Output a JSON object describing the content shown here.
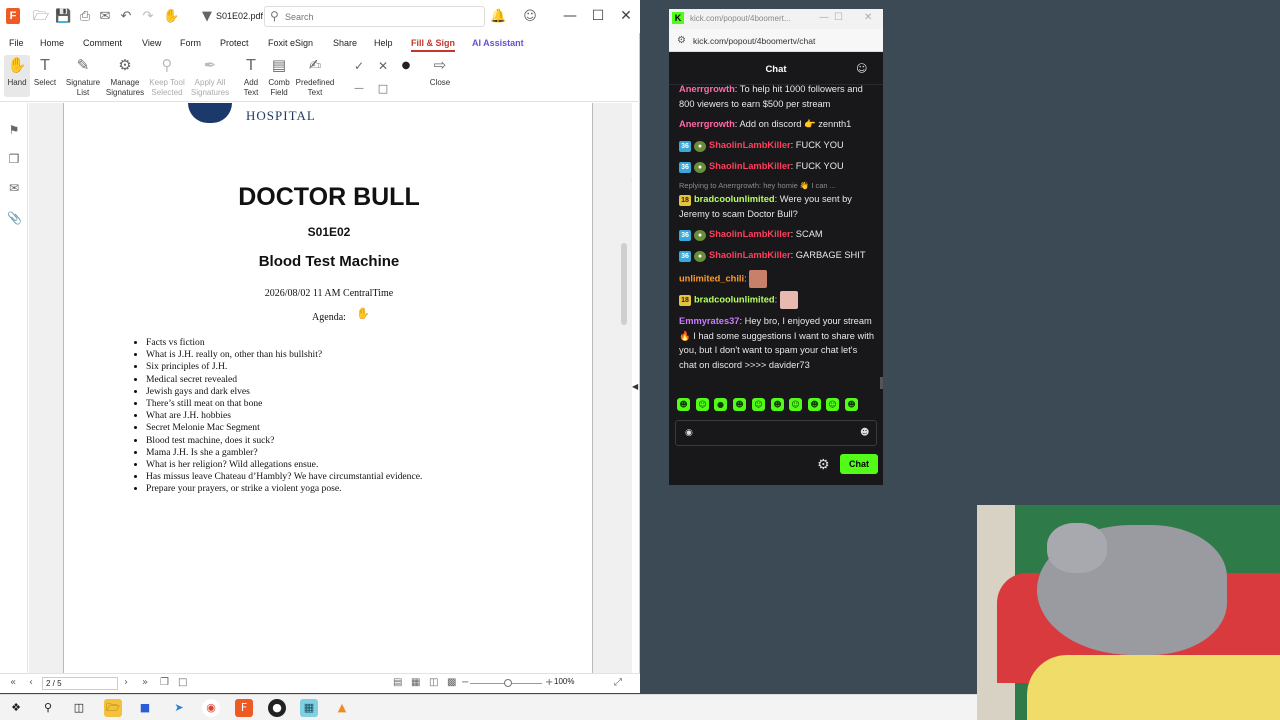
{
  "pdf": {
    "doc_name": "S01E02.pdf *",
    "search_placeholder": "Search",
    "menu": [
      "File",
      "Home",
      "Comment",
      "View",
      "Form",
      "Protect",
      "Foxit eSign",
      "Share",
      "Help",
      "Fill & Sign",
      "AI Assistant"
    ],
    "ribbon": {
      "hand": "Hand",
      "select": "Select",
      "signature_list": "Signature List",
      "manage_signatures": "Manage Signatures",
      "keep_tool_selected": "Keep Tool Selected",
      "apply_all_signatures": "Apply All Signatures",
      "add_text": "Add Text",
      "comb_field": "Comb Field",
      "predefined_text": "Predefined Text",
      "close": "Close"
    },
    "document": {
      "hospital": "HOSPITAL",
      "title": "DOCTOR BULL",
      "episode": "S01E02",
      "subtitle": "Blood Test Machine",
      "datetime": "2026/08/02 11 AM CentralTime",
      "agenda_label": "Agenda:",
      "agenda": [
        "Facts vs fiction",
        "What is J.H. really on, other than his bullshit?",
        "Six principles of J.H.",
        "Medical secret revealed",
        "Jewish gays and dark elves",
        "There’s still meat on that bone",
        "What are J.H. hobbies",
        "Secret Melonie Mac Segment",
        "Blood test machine, does it suck?",
        "Mama J.H. Is she a gambler?",
        "What is her religion? Wild allegations ensue.",
        "Has missus leave Chateau d’Hambly? We have circumstantial evidence.",
        "Prepare your prayers, or strike a violent yoga pose."
      ]
    },
    "status": {
      "page": "2 / 5",
      "zoom": "100%"
    }
  },
  "chat": {
    "window_title": "kick.com/popout/4boomert...",
    "url": "kick.com/popout/4boomertv/chat",
    "heading": "Chat",
    "messages": [
      {
        "user": "Anerrgrowth",
        "text": "To help hit 1000 followers and 800 viewers to earn $500 per stream"
      },
      {
        "user": "Anerrgrowth",
        "text": "Add on discord 👉 zennth1"
      },
      {
        "user": "ShaolinLambKiller",
        "text": "FUCK YOU"
      },
      {
        "user": "ShaolinLambKiller",
        "text": "FUCK YOU"
      },
      {
        "reply": "Replying to Anerrgrowth: hey homie 👋 I can ...",
        "user": "bradcoolunlimited",
        "text": "Were you sent by Jeremy to scam Doctor Bull?"
      },
      {
        "user": "ShaolinLambKiller",
        "text": "SCAM"
      },
      {
        "user": "ShaolinLambKiller",
        "text": "GARBAGE SHIT"
      },
      {
        "user": "unlimited_chili",
        "text": ""
      },
      {
        "user": "bradcoolunlimited",
        "text": ""
      },
      {
        "user": "Emmyrates37",
        "text": "Hey bro, I enjoyed your stream 🔥 I had some suggestions I want to share with you, but I don't want to spam your chat let's chat on discord >>>> davider73"
      }
    ],
    "badges": {
      "sub36": "36",
      "sub18": "18"
    },
    "send_label": "Chat"
  },
  "colors": {
    "kick_green": "#53fc18",
    "foxit_orange": "#ef5a24",
    "chat_bg": "#18181b"
  }
}
